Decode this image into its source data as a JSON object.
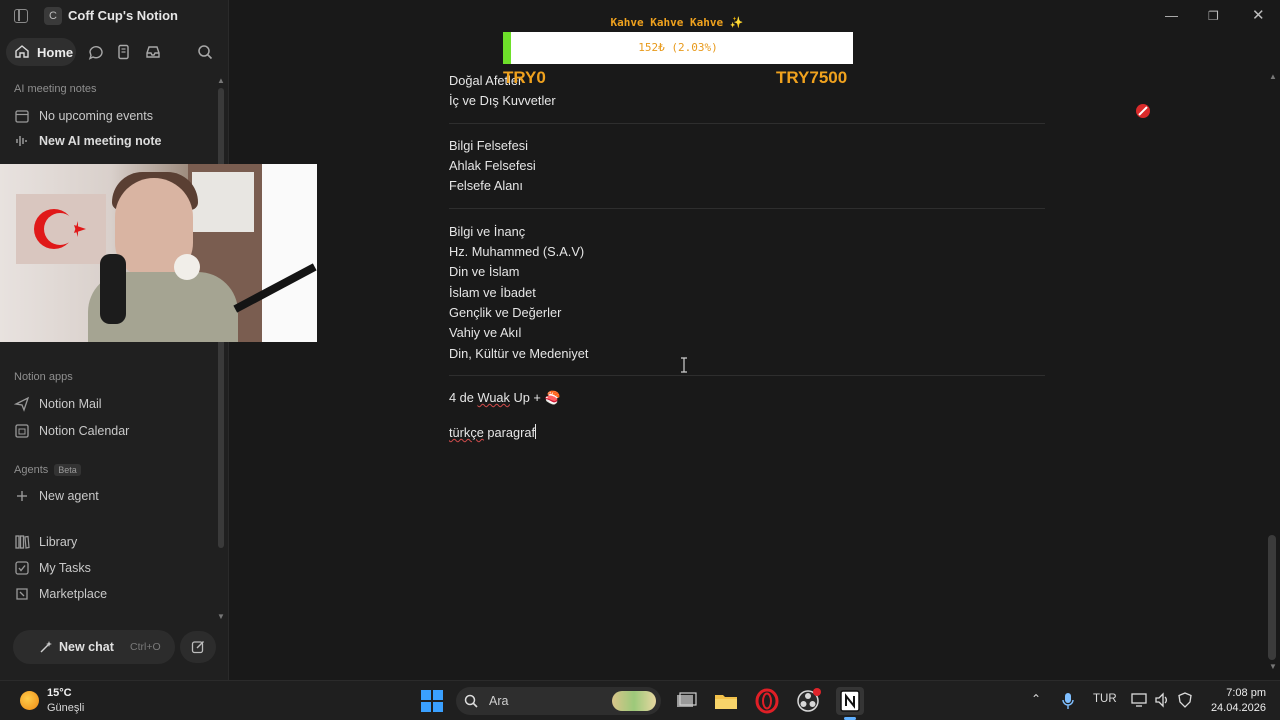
{
  "sidebar": {
    "workspace_initial": "C",
    "workspace_name": "Coff Cup's Notion",
    "home_label": "Home",
    "sections": {
      "ai_meeting_notes": "AI meeting notes",
      "notion_apps": "Notion apps",
      "agents": "Agents",
      "agents_badge": "Beta"
    },
    "items": {
      "no_upcoming": "No upcoming events",
      "new_ai_note": "New AI meeting note",
      "notion_mail": "Notion Mail",
      "notion_calendar": "Notion Calendar",
      "new_agent": "New agent",
      "library": "Library",
      "my_tasks": "My Tasks",
      "marketplace": "Marketplace"
    },
    "new_chat_label": "New chat",
    "new_chat_shortcut": "Ctrl+O"
  },
  "overlay": {
    "goal_title": "Kahve Kahve Kahve ✨",
    "goal_progress_text": "152₺ (2.03%)",
    "goal_progress_fraction": 0.0203,
    "goal_min": "TRY0",
    "goal_max": "TRY7500",
    "colors": {
      "accent": "#f0a21e",
      "fill": "#6ee02a"
    }
  },
  "page": {
    "lines_a": [
      "Doğal Afetler",
      "İç ve Dış Kuvvetler"
    ],
    "lines_b": [
      "Bilgi Felsefesi",
      "Ahlak Felsefesi",
      "Felsefe Alanı"
    ],
    "lines_c": [
      "Bilgi ve İnanç",
      "Hz. Muhammed (S.A.V)",
      "Din ve İslam",
      "İslam ve İbadet",
      "Gençlik ve Değerler",
      "Vahiy ve Akıl",
      "Din, Kültür ve Medeniyet"
    ],
    "todo_prefix": "4 de ",
    "todo_misspelled": "Wuak",
    "todo_suffix": " Up + ",
    "todo_emoji": "🍣",
    "typing_misspelled": "türkçe",
    "typing_rest": " paragraf"
  },
  "taskbar": {
    "weather_temp": "15°C",
    "weather_cond": "Güneşli",
    "search_placeholder": "Ara",
    "lang": "TUR",
    "time": "7:08 pm",
    "date": "24.04.2026"
  }
}
